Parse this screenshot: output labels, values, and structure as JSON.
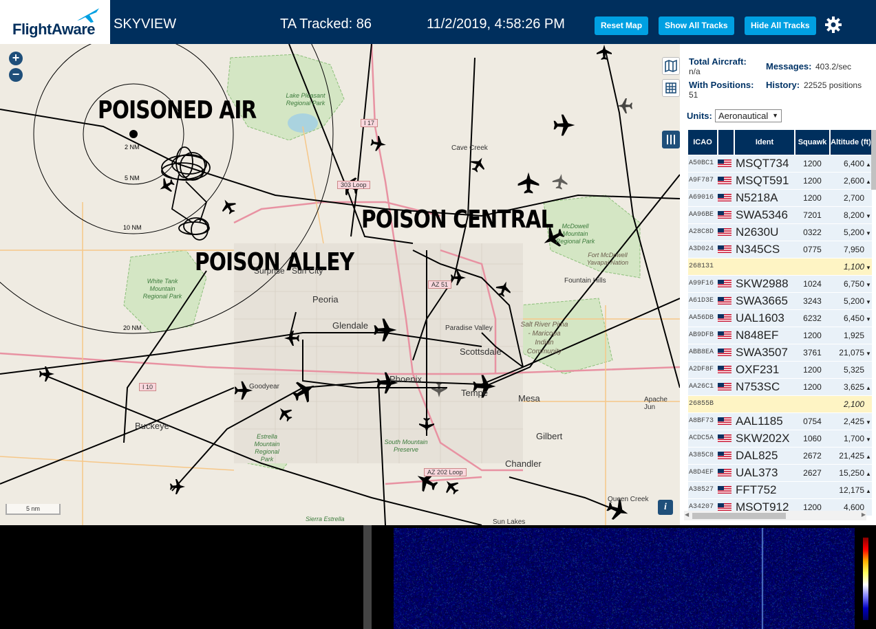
{
  "header": {
    "logo_text": "FlightAware",
    "app_title": "SKYVIEW",
    "tracked": "TA Tracked: 86",
    "datetime": "11/2/2019, 4:58:26 PM",
    "buttons": {
      "reset": "Reset Map",
      "show": "Show All Tracks",
      "hide": "Hide All Tracks"
    },
    "settings_icon": "gear-icon",
    "colors": {
      "bar": "#002F5D",
      "button": "#00A0E2"
    }
  },
  "map": {
    "annotations": [
      "POISONED AIR",
      "POISON ALLEY",
      "POISON CENTRAL"
    ],
    "range_rings": [
      "2 NM",
      "5 NM",
      "10 NM",
      "20 NM"
    ],
    "places": [
      "Peoria",
      "Glendale",
      "Scottsdale",
      "Paradise Valley",
      "Phoenix",
      "Tempe",
      "Mesa",
      "Gilbert",
      "Chandler",
      "Buckeye",
      "Goodyear",
      "Surprise",
      "Sun City",
      "Cave Creek",
      "Fountain Hills",
      "Apache Jun",
      "Queen Creek",
      "Sun Lakes"
    ],
    "parks": [
      "Lake Pleasant Regional Park",
      "White Tank Mountain Regional Park",
      "Estrella Mountain Regional Park",
      "South Mountain Preserve",
      "McDowell Mountain Regional Park",
      "Fort McDowell Yavapai Nation",
      "Salt River Pima - Maricopa Indian Community",
      "Sierra Estrella"
    ],
    "roads": [
      "I 17",
      "303 Loop",
      "AZ 51",
      "I 10",
      "AZ 202 Loop"
    ],
    "scale": "5 nm",
    "zoom_in": "+",
    "zoom_out": "−",
    "info": "i"
  },
  "sidebar": {
    "total_label": "Total Aircraft:",
    "total_value": "n/a",
    "positions_label": "With Positions:",
    "positions_value": "51",
    "messages_label": "Messages:",
    "messages_value": "403.2/sec",
    "history_label": "History:",
    "history_value": "22525 positions",
    "units_label": "Units:",
    "units_value": "Aeronautical",
    "columns": [
      "ICAO",
      "",
      "Ident",
      "Squawk",
      "Altitude (ft)"
    ],
    "rows": [
      {
        "icao": "A50BC1",
        "flag": true,
        "ident": "MSQT734",
        "squawk": "1200",
        "alt": "6,400",
        "trend": "▲",
        "mlat": false
      },
      {
        "icao": "A9F787",
        "flag": true,
        "ident": "MSQT591",
        "squawk": "1200",
        "alt": "2,600",
        "trend": "▲",
        "mlat": false
      },
      {
        "icao": "A69016",
        "flag": true,
        "ident": "N5218A",
        "squawk": "1200",
        "alt": "2,700",
        "trend": "",
        "mlat": false
      },
      {
        "icao": "AA96BE",
        "flag": true,
        "ident": "SWA5346",
        "squawk": "7201",
        "alt": "8,200",
        "trend": "▼",
        "mlat": false
      },
      {
        "icao": "A28C8D",
        "flag": true,
        "ident": "N2630U",
        "squawk": "0322",
        "alt": "5,200",
        "trend": "▼",
        "mlat": false
      },
      {
        "icao": "A3D024",
        "flag": true,
        "ident": "N345CS",
        "squawk": "0775",
        "alt": "7,950",
        "trend": "",
        "mlat": false
      },
      {
        "icao": "268131",
        "flag": false,
        "ident": "",
        "squawk": "",
        "alt": "1,100",
        "trend": "▼",
        "mlat": true
      },
      {
        "icao": "A99F16",
        "flag": true,
        "ident": "SKW2988",
        "squawk": "1024",
        "alt": "6,750",
        "trend": "▼",
        "mlat": false
      },
      {
        "icao": "A61D3E",
        "flag": true,
        "ident": "SWA3665",
        "squawk": "3243",
        "alt": "5,200",
        "trend": "▼",
        "mlat": false
      },
      {
        "icao": "AA56DB",
        "flag": true,
        "ident": "UAL1603",
        "squawk": "6232",
        "alt": "6,450",
        "trend": "▼",
        "mlat": false
      },
      {
        "icao": "AB9DFB",
        "flag": true,
        "ident": "N848EF",
        "squawk": "1200",
        "alt": "1,925",
        "trend": "",
        "mlat": false
      },
      {
        "icao": "ABB8EA",
        "flag": true,
        "ident": "SWA3507",
        "squawk": "3761",
        "alt": "21,075",
        "trend": "▼",
        "mlat": false
      },
      {
        "icao": "A2DF8F",
        "flag": true,
        "ident": "OXF231",
        "squawk": "1200",
        "alt": "5,325",
        "trend": "",
        "mlat": false
      },
      {
        "icao": "AA26C1",
        "flag": true,
        "ident": "N753SC",
        "squawk": "1200",
        "alt": "3,625",
        "trend": "▲",
        "mlat": false
      },
      {
        "icao": "26855B",
        "flag": false,
        "ident": "",
        "squawk": "",
        "alt": "2,100",
        "trend": "",
        "mlat": true
      },
      {
        "icao": "A8BF73",
        "flag": true,
        "ident": "AAL1185",
        "squawk": "0754",
        "alt": "2,425",
        "trend": "▼",
        "mlat": false
      },
      {
        "icao": "ACDC5A",
        "flag": true,
        "ident": "SKW202X",
        "squawk": "1060",
        "alt": "1,700",
        "trend": "▼",
        "mlat": false
      },
      {
        "icao": "A385C8",
        "flag": true,
        "ident": "DAL825",
        "squawk": "2672",
        "alt": "21,425",
        "trend": "▲",
        "mlat": false
      },
      {
        "icao": "A8D4EF",
        "flag": true,
        "ident": "UAL373",
        "squawk": "2627",
        "alt": "15,250",
        "trend": "▲",
        "mlat": false
      },
      {
        "icao": "A38527",
        "flag": true,
        "ident": "FFT752",
        "squawk": "",
        "alt": "12,175",
        "trend": "▲",
        "mlat": false
      },
      {
        "icao": "A34207",
        "flag": true,
        "ident": "MSQT912",
        "squawk": "1200",
        "alt": "4,600",
        "trend": "",
        "mlat": false
      }
    ]
  }
}
